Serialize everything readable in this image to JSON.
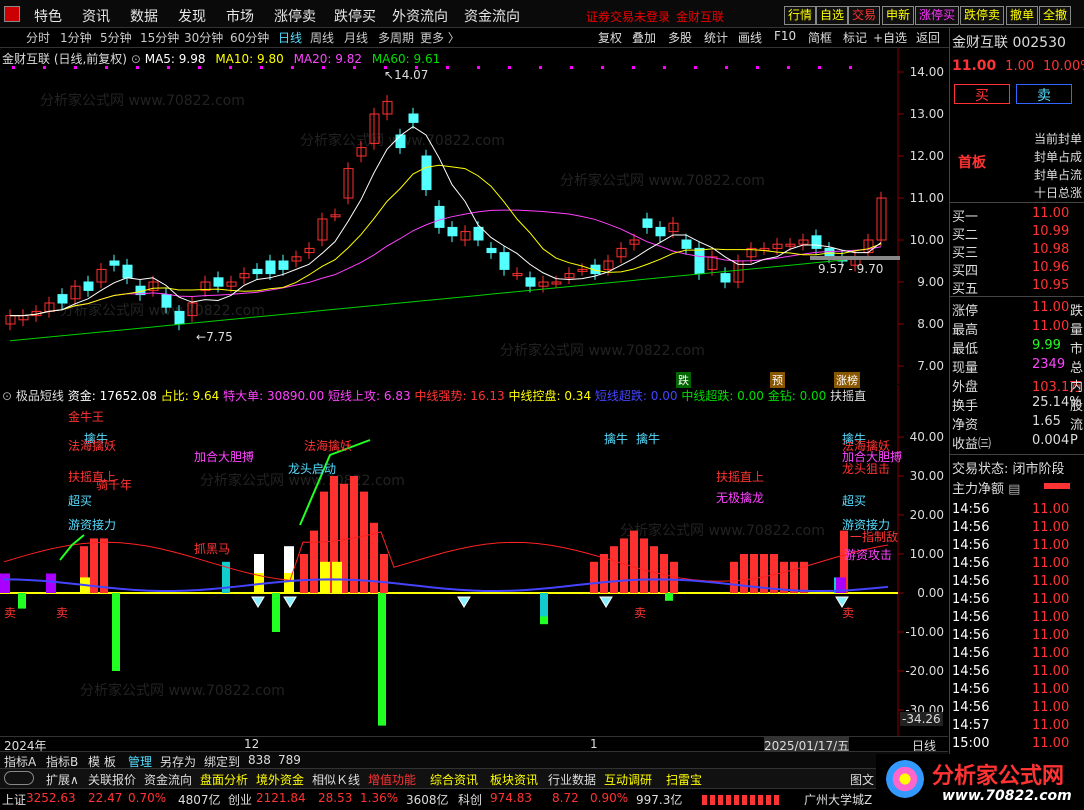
{
  "menu": {
    "items": [
      "特色",
      "资讯",
      "数据",
      "发现",
      "市场",
      "涨停卖",
      "跌停买",
      "外资流向",
      "资金流向"
    ],
    "login": "证券交易未登录",
    "stock_title": "金财互联",
    "right_buttons": [
      "行情",
      "自选",
      "交易",
      "申新",
      "涨停买",
      "跌停卖",
      "撤单",
      "全撤"
    ]
  },
  "timeframes": {
    "items": [
      "分时",
      "1分钟",
      "5分钟",
      "15分钟",
      "30分钟",
      "60分钟",
      "日线",
      "周线",
      "月线",
      "多周期",
      "更多 〉"
    ],
    "active": "日线",
    "tools": [
      "复权",
      "叠加",
      "多股",
      "统计",
      "画线",
      "F10",
      "简框",
      "标记",
      "+自选",
      "返回"
    ]
  },
  "main_indicator": {
    "name": "金财互联 (日线,前复权)",
    "ma5": "MA5: 9.98",
    "ma10": "MA10: 9.80",
    "ma20": "MA20: 9.82",
    "ma60": "MA60: 9.61",
    "high_label": "14.07",
    "low_label": "7.75",
    "range_label": "9.57 - 9.70",
    "y_ticks": [
      "14.00",
      "13.00",
      "12.00",
      "11.00",
      "10.00",
      "9.00",
      "8.00",
      "7.00"
    ]
  },
  "sub_indicator": {
    "name": "极品短线",
    "funds": "资金: 17652.08",
    "ratio": "占比: 9.64",
    "big_order": "特大单: 30890.00",
    "short_attack": "短线上攻: 6.83",
    "mid_strong": "中线强势: 16.13",
    "mid_control": "中线控盘: 0.34",
    "short_drop": "短线超跌: 0.00",
    "mid_drop": "中线超跌: 0.00",
    "gold_drill": "金钻: 0.00",
    "support": "扶摇直",
    "tags_top": [
      "跌",
      "预",
      "涨榜"
    ],
    "y_ticks": [
      "40.00",
      "30.00",
      "20.00",
      "10.00",
      "0.00",
      "-10.00",
      "-20.00",
      "-30.00"
    ],
    "last_value": "-34.26",
    "signals": [
      "金牛王",
      "擒牛",
      "法海擒妖",
      "扶摇直上",
      "骑千年",
      "超买",
      "游资接力",
      "加合大胆搏",
      "法海擒妖",
      "龙头启动",
      "抓黑马",
      "擒牛",
      "擒牛",
      "扶摇直上",
      "无极擒龙",
      "擒牛",
      "法海擒妖",
      "加合大胆搏",
      "龙头狙击",
      "超买",
      "游资接力",
      "一指制敌",
      "游资攻击"
    ],
    "sell_marks": [
      "卖",
      "卖",
      "卖",
      "卖"
    ]
  },
  "x_axis": {
    "labels": [
      "2024年",
      "12",
      "1",
      "2025/01/17/五"
    ],
    "period": "日线"
  },
  "bottom_tabs": [
    "指标A",
    "指标B",
    "模 板",
    "管理",
    "另存为",
    "绑定到",
    "838",
    "789"
  ],
  "bottom_bar": [
    "扩展∧",
    "关联报价",
    "资金流向",
    "盘面分析",
    "境外资金",
    "相似Ｋ线",
    "增值功能",
    "综合资讯",
    "板块资讯",
    "行业数据",
    "互动调研",
    "扫雷宝",
    "图文"
  ],
  "ticker": {
    "sh_label": "上证",
    "sh_value": "3252.63",
    "sh_change": "22.47",
    "sh_pct": "0.70%",
    "sh_amount": "4807亿",
    "cy_label": "创业",
    "cy_value": "2121.84",
    "cy_change": "28.53",
    "cy_pct": "1.36%",
    "cy_amount": "3608亿",
    "kc_label": "科创",
    "kc_value": "974.83",
    "kc_change": "8.72",
    "kc_pct": "0.90%",
    "kc_amount": "997.3亿",
    "news": "广州大学城Z"
  },
  "right_panel": {
    "name": "金财互联",
    "code": "002530",
    "price": "11.00",
    "change": "1.00",
    "pct": "10.00%",
    "buy_btn": "买",
    "sell_btn": "卖",
    "board": "首板",
    "notes": [
      "当前封单",
      "封单占成",
      "封单占流",
      "十日总涨"
    ],
    "bids": [
      {
        "label": "买一",
        "price": "11.00"
      },
      {
        "label": "买二",
        "price": "10.99"
      },
      {
        "label": "买三",
        "price": "10.98"
      },
      {
        "label": "买四",
        "price": "10.96"
      },
      {
        "label": "买五",
        "price": "10.95"
      }
    ],
    "stats": [
      {
        "label": "涨停",
        "value": "11.00",
        "ext": "跌"
      },
      {
        "label": "最高",
        "value": "11.00",
        "ext": "量"
      },
      {
        "label": "最低",
        "value": "9.99",
        "ext": "市"
      },
      {
        "label": "现量",
        "value": "2349",
        "ext": "总"
      },
      {
        "label": "外盘",
        "value": "103.1万",
        "ext": "内"
      },
      {
        "label": "换手",
        "value": "25.14%",
        "ext": "股"
      },
      {
        "label": "净资",
        "value": "1.65",
        "ext": "流"
      },
      {
        "label": "收益㈢",
        "value": "0.004",
        "ext": "P"
      }
    ],
    "trade_status": "交易状态: 闭市阶段",
    "main_flow": "主力净额",
    "ticks": [
      {
        "time": "14:56",
        "price": "11.00"
      },
      {
        "time": "14:56",
        "price": "11.00"
      },
      {
        "time": "14:56",
        "price": "11.00"
      },
      {
        "time": "14:56",
        "price": "11.00"
      },
      {
        "time": "14:56",
        "price": "11.00"
      },
      {
        "time": "14:56",
        "price": "11.00"
      },
      {
        "time": "14:56",
        "price": "11.00"
      },
      {
        "time": "14:56",
        "price": "11.00"
      },
      {
        "time": "14:56",
        "price": "11.00"
      },
      {
        "time": "14:56",
        "price": "11.00"
      },
      {
        "time": "14:56",
        "price": "11.00"
      },
      {
        "time": "14:56",
        "price": "11.00"
      },
      {
        "time": "14:57",
        "price": "11.00"
      },
      {
        "time": "15:00",
        "price": "11.00"
      }
    ]
  },
  "brand": "分析家公式网",
  "brand_url": "www.70822.com",
  "watermark": "分析家公式网 www.70822.com",
  "colors": {
    "up": "#ff3030",
    "down": "#54ffff",
    "ma5": "#ffffff",
    "ma10": "#ffff00",
    "ma20": "#ff40ff",
    "ma60": "#00d000"
  }
}
